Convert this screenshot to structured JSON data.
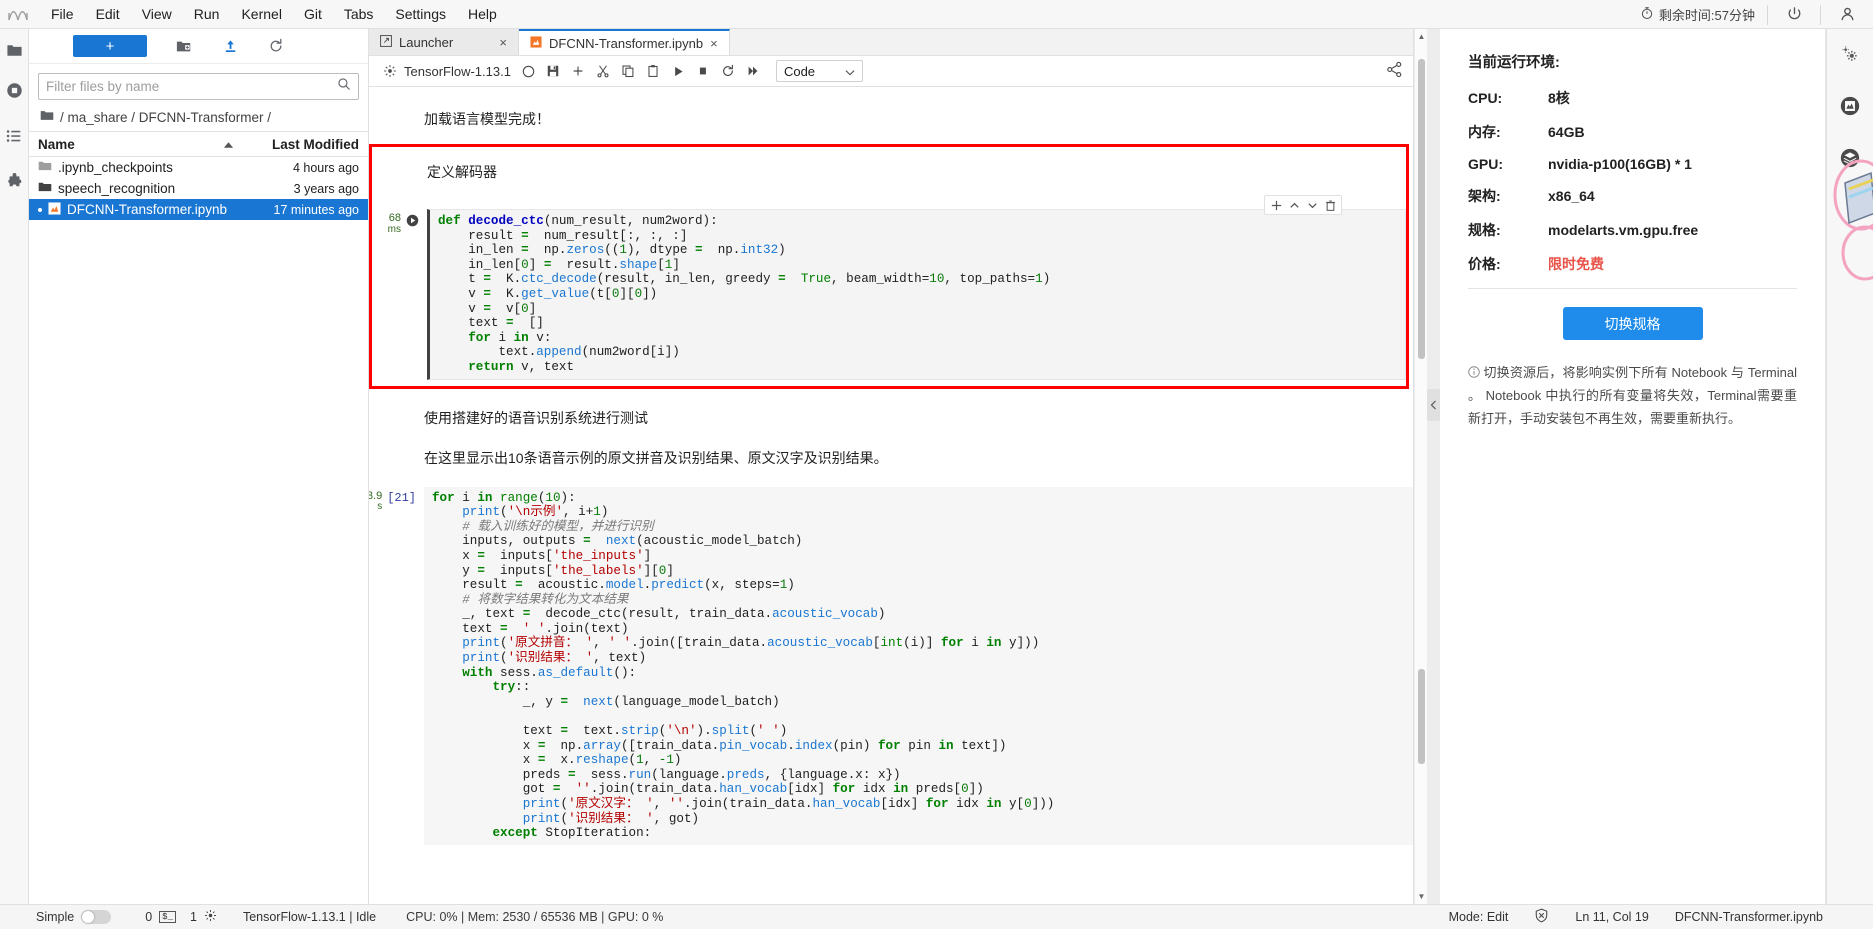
{
  "menubar": {
    "items": [
      "File",
      "Edit",
      "View",
      "Run",
      "Kernel",
      "Git",
      "Tabs",
      "Settings",
      "Help"
    ],
    "timer_label": "剩余时间:57分钟",
    "power_icon": "power-icon",
    "user_icon": "user-icon",
    "logo_icon": "jupyter-logo-icon"
  },
  "leftrail": {
    "items": [
      {
        "name": "folder-icon",
        "label": "File Browser"
      },
      {
        "name": "running-icon",
        "label": "Running Terminals and Kernels"
      },
      {
        "name": "commands-icon",
        "label": "Commands"
      },
      {
        "name": "extension-icon",
        "label": "Extension Manager"
      }
    ]
  },
  "filebrowser": {
    "new_button_label": "+",
    "toolbar_icons": [
      "new-folder-icon",
      "upload-icon",
      "refresh-icon"
    ],
    "filter_placeholder": "Filter files by name",
    "filter_value": "",
    "search_icon": "search-icon",
    "breadcrumb": "/ ma_share / DFCNN-Transformer /",
    "columns": {
      "name": "Name",
      "modified": "Last Modified"
    },
    "sort_icon": "sort-ascending-icon",
    "rows": [
      {
        "icon": "folder-icon",
        "name": ".ipynb_checkpoints",
        "modified": "4 hours ago",
        "selected": false
      },
      {
        "icon": "folder-icon",
        "name": "speech_recognition",
        "modified": "3 years ago",
        "selected": false
      },
      {
        "icon": "notebook-icon",
        "name": "DFCNN-Transformer.ipynb",
        "modified": "17 minutes ago",
        "selected": true
      }
    ]
  },
  "notebook": {
    "tabs": [
      {
        "label": "Launcher",
        "icon": "launcher-icon",
        "active": false,
        "close": "×"
      },
      {
        "label": "DFCNN-Transformer.ipynb",
        "icon": "notebook-icon",
        "active": true,
        "close": "×"
      }
    ],
    "toolbar": {
      "kernel_icon": "kernel-icon",
      "kernel_name": "TensorFlow-1.13.1",
      "busy_indicator": "kernel-idle-circle-icon",
      "icons": [
        "save-icon",
        "insert-cell-icon",
        "cut-icon",
        "copy-icon",
        "paste-icon",
        "run-icon",
        "stop-icon",
        "restart-icon",
        "restart-run-all-icon"
      ],
      "celltype_value": "Code",
      "celltype_caret": "chevron-down-icon",
      "share_icon": "share-icon"
    },
    "cell_actions": [
      "plus-icon",
      "chevron-up-icon",
      "chevron-down-icon",
      "trash-icon"
    ],
    "output_text": "加载语言模型完成！",
    "md1": "定义解码器",
    "md2": "使用搭建好的语音识别系统进行测试",
    "md3": "在这里显示出10条语音示例的原文拼音及识别结果、原文汉字及识别结果。",
    "cell1": {
      "timing": "68",
      "timing_unit": "ms",
      "prompt": "",
      "highlighted": true,
      "lines": [
        [
          [
            "k",
            "def "
          ],
          [
            "fn",
            "decode_ctc"
          ],
          [
            "",
            "(num_result, num2word):"
          ]
        ],
        [
          [
            "",
            "    result "
          ],
          [
            "k",
            "="
          ],
          [
            "",
            "  num_result[:, :, :]"
          ]
        ],
        [
          [
            "",
            "    in_len "
          ],
          [
            "k",
            "="
          ],
          [
            "",
            "  np."
          ],
          [
            "at",
            "zeros"
          ],
          [
            "",
            "(("
          ],
          [
            "nu",
            "1"
          ],
          [
            "",
            "), dtype "
          ],
          [
            "k",
            "="
          ],
          [
            "",
            "  np."
          ],
          [
            "at",
            "int32"
          ],
          [
            "",
            ")"
          ]
        ],
        [
          [
            "",
            "    in_len["
          ],
          [
            "nu",
            "0"
          ],
          [
            "",
            "] "
          ],
          [
            "k",
            "="
          ],
          [
            "",
            "  result."
          ],
          [
            "at",
            "shape"
          ],
          [
            "",
            "["
          ],
          [
            "nu",
            "1"
          ],
          [
            "",
            "]"
          ]
        ],
        [
          [
            "",
            "    t "
          ],
          [
            "k",
            "="
          ],
          [
            "",
            "  K."
          ],
          [
            "at",
            "ctc_decode"
          ],
          [
            "",
            "(result, in_len, greedy "
          ],
          [
            "k",
            "="
          ],
          [
            "",
            "  "
          ],
          [
            "bi",
            "True"
          ],
          [
            "",
            ", beam_width="
          ],
          [
            "nu",
            "10"
          ],
          [
            "",
            ", top_paths="
          ],
          [
            "nu",
            "1"
          ],
          [
            "",
            ")"
          ]
        ],
        [
          [
            "",
            "    v "
          ],
          [
            "k",
            "="
          ],
          [
            "",
            "  K."
          ],
          [
            "at",
            "get_value"
          ],
          [
            "",
            "(t["
          ],
          [
            "nu",
            "0"
          ],
          [
            "",
            "]["
          ],
          [
            "nu",
            "0"
          ],
          [
            "",
            "])"
          ]
        ],
        [
          [
            "",
            "    v "
          ],
          [
            "k",
            "="
          ],
          [
            "",
            "  v["
          ],
          [
            "nu",
            "0"
          ],
          [
            "",
            "]"
          ]
        ],
        [
          [
            "",
            "    text "
          ],
          [
            "k",
            "="
          ],
          [
            "",
            "  []"
          ]
        ],
        [
          [
            "k",
            "    for "
          ],
          [
            "",
            "i "
          ],
          [
            "k",
            "in "
          ],
          [
            "",
            "v:"
          ]
        ],
        [
          [
            "",
            "        text."
          ],
          [
            "at",
            "append"
          ],
          [
            "",
            "(num2word[i])"
          ]
        ],
        [
          [
            "k",
            "    return "
          ],
          [
            "",
            "v, text"
          ]
        ]
      ]
    },
    "cell2": {
      "timing": "3.9",
      "timing_unit": "s",
      "prompt": "[21]",
      "highlighted": false,
      "lines": [
        [
          [
            "k",
            "for "
          ],
          [
            "",
            "i "
          ],
          [
            "k",
            "in "
          ],
          [
            "bi",
            "range"
          ],
          [
            "",
            "("
          ],
          [
            "nu",
            "10"
          ],
          [
            "",
            "):"
          ]
        ],
        [
          [
            "",
            "    "
          ],
          [
            "at",
            "print"
          ],
          [
            "",
            "("
          ],
          [
            "st",
            "'\\n示例'"
          ],
          [
            "",
            ", i+"
          ],
          [
            "nu",
            "1"
          ],
          [
            "",
            ")"
          ]
        ],
        [
          [
            "cm",
            "    # 载入训练好的模型，并进行识别"
          ]
        ],
        [
          [
            "",
            "    inputs, outputs "
          ],
          [
            "k",
            "="
          ],
          [
            "",
            "  "
          ],
          [
            "at",
            "next"
          ],
          [
            "",
            "(acoustic_model_batch)"
          ]
        ],
        [
          [
            "",
            "    x "
          ],
          [
            "k",
            "="
          ],
          [
            "",
            "  inputs["
          ],
          [
            "st",
            "'the_inputs'"
          ],
          [
            "",
            "]"
          ]
        ],
        [
          [
            "",
            "    y "
          ],
          [
            "k",
            "="
          ],
          [
            "",
            "  inputs["
          ],
          [
            "st",
            "'the_labels'"
          ],
          [
            "",
            "]["
          ],
          [
            "nu",
            "0"
          ],
          [
            "",
            "]"
          ]
        ],
        [
          [
            "",
            "    result "
          ],
          [
            "k",
            "="
          ],
          [
            "",
            "  acoustic."
          ],
          [
            "at",
            "model"
          ],
          [
            "",
            "."
          ],
          [
            "at",
            "predict"
          ],
          [
            "",
            "(x, steps="
          ],
          [
            "nu",
            "1"
          ],
          [
            "",
            ")"
          ]
        ],
        [
          [
            "cm",
            "    # 将数字结果转化为文本结果"
          ]
        ],
        [
          [
            "",
            "    _, text "
          ],
          [
            "k",
            "="
          ],
          [
            "",
            "  decode_ctc(result, train_data."
          ],
          [
            "at",
            "acoustic_vocab"
          ],
          [
            "",
            ")"
          ]
        ],
        [
          [
            "",
            "    text "
          ],
          [
            "k",
            "="
          ],
          [
            "",
            "  "
          ],
          [
            "st",
            "' '"
          ],
          [
            "",
            ".join(text)"
          ]
        ],
        [
          [
            "",
            "    "
          ],
          [
            "at",
            "print"
          ],
          [
            "",
            "("
          ],
          [
            "st",
            "'原文拼音： '"
          ],
          [
            "",
            ", "
          ],
          [
            "st",
            "' '"
          ],
          [
            "",
            ".join([train_data."
          ],
          [
            "at",
            "acoustic_vocab"
          ],
          [
            "",
            "["
          ],
          [
            "bi",
            "int"
          ],
          [
            "",
            "(i)] "
          ],
          [
            "k",
            "for "
          ],
          [
            "",
            "i "
          ],
          [
            "k",
            "in "
          ],
          [
            "",
            "y]))"
          ]
        ],
        [
          [
            "",
            "    "
          ],
          [
            "at",
            "print"
          ],
          [
            "",
            "("
          ],
          [
            "st",
            "'识别结果： '"
          ],
          [
            "",
            ", text)"
          ]
        ],
        [
          [
            "k",
            "    with "
          ],
          [
            "",
            "sess."
          ],
          [
            "at",
            "as_default"
          ],
          [
            "",
            "():"
          ]
        ],
        [
          [
            "k",
            "        try"
          ],
          [
            "",
            "::"
          ]
        ],
        [
          [
            "",
            "            _, y "
          ],
          [
            "k",
            "="
          ],
          [
            "",
            "  "
          ],
          [
            "at",
            "next"
          ],
          [
            "",
            "(language_model_batch)"
          ]
        ],
        [
          [
            "",
            ""
          ]
        ],
        [
          [
            "",
            "            text "
          ],
          [
            "k",
            "="
          ],
          [
            "",
            "  text."
          ],
          [
            "at",
            "strip"
          ],
          [
            "",
            "("
          ],
          [
            "st",
            "'\\n'"
          ],
          [
            "",
            ")."
          ],
          [
            "at",
            "split"
          ],
          [
            "",
            "("
          ],
          [
            "st",
            "' '"
          ],
          [
            "",
            ")"
          ]
        ],
        [
          [
            "",
            "            x "
          ],
          [
            "k",
            "="
          ],
          [
            "",
            "  np."
          ],
          [
            "at",
            "array"
          ],
          [
            "",
            "([train_data."
          ],
          [
            "at",
            "pin_vocab"
          ],
          [
            "",
            "."
          ],
          [
            "at",
            "index"
          ],
          [
            "",
            "(pin) "
          ],
          [
            "k",
            "for "
          ],
          [
            "",
            "pin "
          ],
          [
            "k",
            "in "
          ],
          [
            "",
            "text])"
          ]
        ],
        [
          [
            "",
            "            x "
          ],
          [
            "k",
            "="
          ],
          [
            "",
            "  x."
          ],
          [
            "at",
            "reshape"
          ],
          [
            "",
            "("
          ],
          [
            "nu",
            "1"
          ],
          [
            "",
            ", "
          ],
          [
            "nu",
            "-1"
          ],
          [
            "",
            ")"
          ]
        ],
        [
          [
            "",
            "            preds "
          ],
          [
            "k",
            "="
          ],
          [
            "",
            "  sess."
          ],
          [
            "at",
            "run"
          ],
          [
            "",
            "(language."
          ],
          [
            "at",
            "preds"
          ],
          [
            "",
            ", {language.x: x})"
          ]
        ],
        [
          [
            "",
            "            got "
          ],
          [
            "k",
            "="
          ],
          [
            "",
            "  "
          ],
          [
            "st",
            "''"
          ],
          [
            "",
            ".join(train_data."
          ],
          [
            "at",
            "han_vocab"
          ],
          [
            "",
            "[idx] "
          ],
          [
            "k",
            "for "
          ],
          [
            "",
            "idx "
          ],
          [
            "k",
            "in "
          ],
          [
            "",
            "preds["
          ],
          [
            "nu",
            "0"
          ],
          [
            "",
            "])"
          ]
        ],
        [
          [
            "",
            "            "
          ],
          [
            "at",
            "print"
          ],
          [
            "",
            "("
          ],
          [
            "st",
            "'原文汉字： '"
          ],
          [
            "",
            ", "
          ],
          [
            "st",
            "''"
          ],
          [
            "",
            ".join(train_data."
          ],
          [
            "at",
            "han_vocab"
          ],
          [
            "",
            "[idx] "
          ],
          [
            "k",
            "for "
          ],
          [
            "",
            "idx "
          ],
          [
            "k",
            "in "
          ],
          [
            "",
            "y["
          ],
          [
            "nu",
            "0"
          ],
          [
            "",
            "]))"
          ]
        ],
        [
          [
            "",
            "            "
          ],
          [
            "at",
            "print"
          ],
          [
            "",
            "("
          ],
          [
            "st",
            "'识别结果： '"
          ],
          [
            "",
            ", got)"
          ]
        ],
        [
          [
            "k",
            "        except "
          ],
          [
            "",
            "StopIteration:"
          ]
        ]
      ]
    }
  },
  "rightpanel": {
    "title": "当前运行环境:",
    "rows": [
      {
        "key": "CPU:",
        "value": "8核",
        "highlight": false
      },
      {
        "key": "内存:",
        "value": "64GB",
        "highlight": false
      },
      {
        "key": "GPU:",
        "value": "nvidia-p100(16GB) * 1",
        "highlight": false
      },
      {
        "key": "架构:",
        "value": "x86_64",
        "highlight": false
      },
      {
        "key": "规格:",
        "value": "modelarts.vm.gpu.free",
        "highlight": false
      },
      {
        "key": "价格:",
        "value": "限时免费",
        "highlight": true
      }
    ],
    "switch_button": "切换规格",
    "note_icon": "info-icon",
    "note": "切换资源后，将影响实例下所有 Notebook 与 Terminal 。 Notebook 中执行的所有变量将失效，Terminal需要重新打开，手动安装包不再生效，需要重新执行。",
    "accent_color": "#1f8ceb",
    "free_color": "#e8534a"
  },
  "rightrail": {
    "items": [
      {
        "name": "settings-gear-icon"
      },
      {
        "name": "notebook-preview-icon"
      },
      {
        "name": "layers-icon"
      }
    ]
  },
  "statusbar": {
    "simple_label": "Simple",
    "toggle_state": "off",
    "terminals_count": "0",
    "terminal_icon": "terminal-icon",
    "kernels_count": "1",
    "kernel_icon": "kernel-icon",
    "kernel_status": "TensorFlow-1.13.1 | Idle",
    "resources": "CPU: 0% | Mem: 2530 / 65536 MB | GPU: 0 %",
    "mode": "Mode: Edit",
    "trust_icon": "untrusted-shield-icon",
    "cursor": "Ln 11, Col 19",
    "filename": "DFCNN-Transformer.ipynb"
  }
}
